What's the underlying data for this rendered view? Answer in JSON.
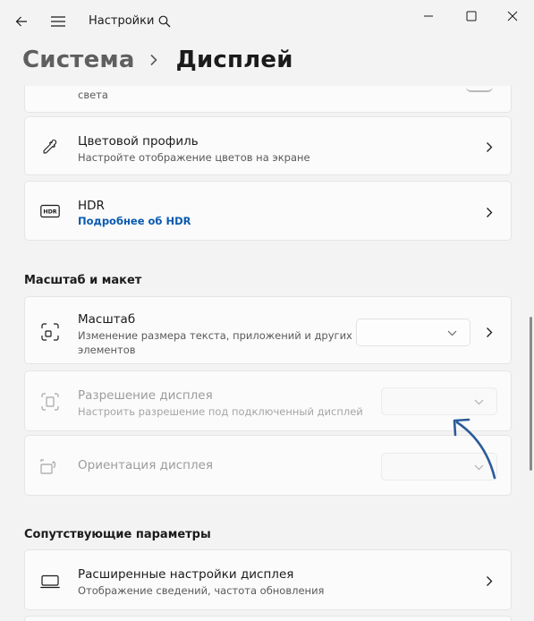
{
  "window": {
    "title": "Настройки"
  },
  "breadcrumb": {
    "parent": "Система",
    "current": "Дисплей"
  },
  "cards": {
    "night_light_sub": "света",
    "color_profile": {
      "title": "Цветовой профиль",
      "subtitle": "Настройте отображение цветов на экране"
    },
    "hdr": {
      "title": "HDR",
      "link": "Подробнее об HDR"
    }
  },
  "section_scale": {
    "heading": "Масштаб и макет",
    "scale": {
      "title": "Масштаб",
      "subtitle_line1": "Изменение размера текста, приложений и других",
      "subtitle_line2": "элементов"
    },
    "resolution": {
      "title": "Разрешение дисплея",
      "subtitle": "Настроить разрешение под подключенный дисплей"
    },
    "orientation": {
      "title": "Ориентация дисплея"
    }
  },
  "section_related": {
    "heading": "Сопутствующие параметры",
    "advanced": {
      "title": "Расширенные настройки дисплея",
      "subtitle": "Отображение сведений, частота обновления"
    }
  },
  "colors": {
    "background": "#f3f3f3",
    "card": "#fbfbfb",
    "link": "#0a5ab0",
    "annotation_arrow": "#2a5c9a"
  },
  "icons": [
    "back-arrow-icon",
    "hamburger-menu-icon",
    "search-icon",
    "minimize-icon",
    "maximize-icon",
    "close-icon",
    "chevron-right-icon",
    "eyedropper-icon",
    "hdr-icon",
    "scale-icon",
    "resolution-icon",
    "orientation-icon",
    "monitor-icon",
    "chevron-down-icon"
  ]
}
